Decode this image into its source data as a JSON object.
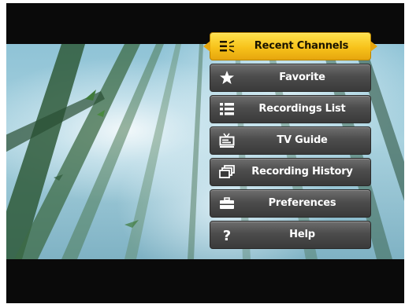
{
  "menu": {
    "items": [
      {
        "label": "Recent Channels",
        "icon": "recent-channels-icon",
        "selected": true
      },
      {
        "label": "Favorite",
        "icon": "star-icon",
        "selected": false
      },
      {
        "label": "Recordings List",
        "icon": "list-icon",
        "selected": false
      },
      {
        "label": "TV Guide",
        "icon": "tv-icon",
        "selected": false
      },
      {
        "label": "Recording History",
        "icon": "history-icon",
        "selected": false
      },
      {
        "label": "Preferences",
        "icon": "toolbox-icon",
        "selected": false
      },
      {
        "label": "Help",
        "icon": "question-icon",
        "selected": false
      }
    ]
  },
  "colors": {
    "selected": "#f7c21a",
    "item": "#4c4c4c",
    "background": "#0a0a0a"
  }
}
